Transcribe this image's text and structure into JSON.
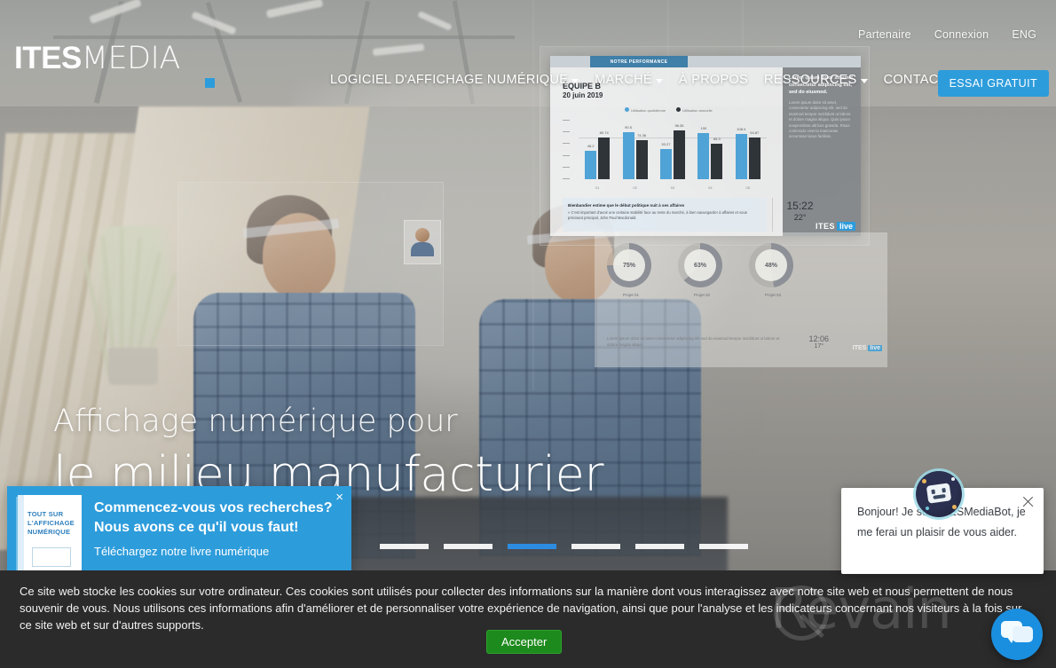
{
  "brand": {
    "logo_bold": "ITES",
    "logo_light": "MEDIA",
    "accent_color": "#2d9cdb"
  },
  "utility_nav": {
    "items": [
      {
        "label": "Partenaire"
      },
      {
        "label": "Connexion"
      },
      {
        "label": "ENG"
      }
    ]
  },
  "main_nav": {
    "items": [
      {
        "label": "LOGICIEL D'AFFICHAGE NUMÉRIQUE",
        "has_caret": true
      },
      {
        "label": "MARCHÉ",
        "has_caret": true
      },
      {
        "label": "À PROPOS",
        "has_caret": false
      },
      {
        "label": "RESSOURCES",
        "has_caret": true
      },
      {
        "label": "CONTACT",
        "has_caret": false
      }
    ],
    "cta_label": "ESSAI GRATUIT"
  },
  "hero": {
    "line1": "Affichage numérique pour",
    "line2": "le milieu manufacturier",
    "slides": {
      "count": 6,
      "active_index": 3
    }
  },
  "dashboard": {
    "tab_label": "NOTRE PERFORMANCE",
    "title": "ÉQUIPE B",
    "date": "20 juin 2019",
    "legend": [
      {
        "label": "Utilisation quotidienne",
        "color": "#4fa3d6"
      },
      {
        "label": "Utilisation annuelle",
        "color": "#2f3439"
      }
    ],
    "news_title": "Bienbandier estime que le début politique nuit à ses affaires",
    "news_body": "« C'est important d'avoir une certaine stabilité face au reste du marché, à bien sauvegarder à affaires et vous précisant principal, John Paul Macdonald.",
    "time": "15:22",
    "temp": "22°",
    "side_heading": "Lorem ipsum dolor sit amet, consectetur adipiscing elit, sed do eiusmod.",
    "side_body": "Lorem ipsum dolor sit amet, consectetur adipiscing elit, sed do eiusmod tempor incididunt ut labore et dolore magna aliqua. Quis ipsum suspendisse ultrices gravida. Risus commodo viverra maecenas accumsan lacus facilisis.",
    "logo_word1": "ITES",
    "logo_word2": "live"
  },
  "dashboard2": {
    "gauges": [
      {
        "value": "75%",
        "label": "Projet 01",
        "pct": 75
      },
      {
        "value": "63%",
        "label": "Projet 02",
        "pct": 63
      },
      {
        "value": "48%",
        "label": "Projet 03",
        "pct": 48
      }
    ],
    "footer_text": "Lorem ipsum dolor sit amet consectetur adipiscing elit sed do eiusmod tempor incididunt ut labore et dolore magna aliqua.",
    "time": "12:06",
    "temp": "17°",
    "logo_word1": "ITES",
    "logo_word2": "live"
  },
  "chart_data": {
    "type": "bar",
    "title": "ÉQUIPE B",
    "subtitle": "20 juin 2019",
    "categories": [
      "01",
      "02",
      "03",
      "04",
      "05"
    ],
    "series": [
      {
        "name": "Utilisation quotidienne",
        "color": "#4fa3d6",
        "values": [
          48.2,
          90.5,
          53.27,
          100.0,
          108.4
        ]
      },
      {
        "name": "Utilisation annuelle",
        "color": "#2f3439",
        "values": [
          80.74,
          74.36,
          98.35,
          65.3,
          94.87
        ]
      }
    ],
    "ylim": [
      0,
      120
    ],
    "grid": true,
    "legend_position": "top"
  },
  "promo": {
    "heading": "Commencez-vous vos recherches? Nous avons ce qu'il vous faut!",
    "subtext": "Téléchargez notre livre numérique",
    "ebook_title": "TOUT SUR L'AFFICHAGE NUMÉRIQUE",
    "close_label": "×"
  },
  "cookie": {
    "text": "Ce site web stocke les cookies sur votre ordinateur. Ces cookies sont utilisés pour collecter des informations sur la manière dont vous interagissez avec notre site web et nous permettent de nous souvenir de vous. Nous utilisons ces informations afin d'améliorer et de personnaliser votre expérience de navigation, ainsi que pour l'analyse et les indicateurs concernant nos visiteurs à la fois sur ce site web et sur d'autres supports.",
    "accept_label": "Accepter"
  },
  "chat": {
    "message": "Bonjour! Je suis ITESMediaBot, je me ferai un plaisir de vous aider.",
    "bot_name": "ITESMediaBot"
  },
  "watermark": {
    "text": "Revain"
  }
}
